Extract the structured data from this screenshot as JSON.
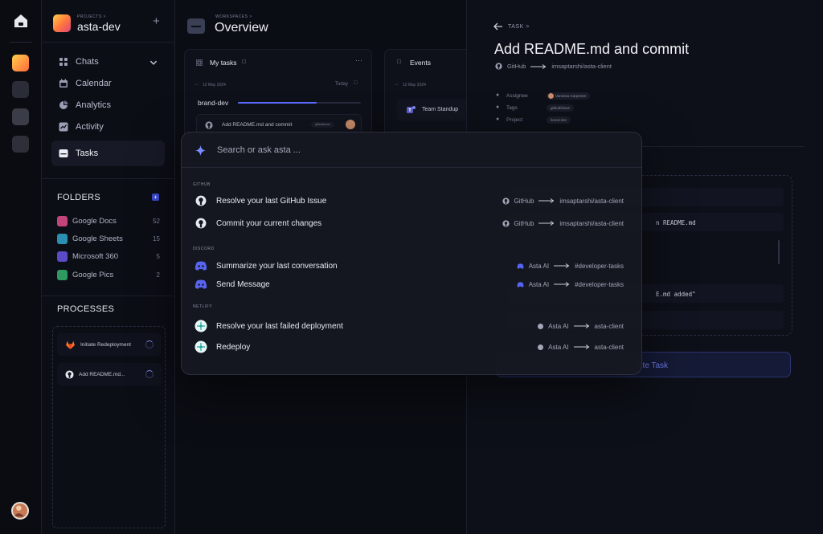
{
  "project": {
    "crumb": "PROJECTS >",
    "name": "asta-dev"
  },
  "nav": [
    {
      "label": "Chats",
      "icon": "chats-icon"
    },
    {
      "label": "Calendar",
      "icon": "calendar-icon"
    },
    {
      "label": "Analytics",
      "icon": "analytics-icon"
    },
    {
      "label": "Activity",
      "icon": "activity-icon"
    },
    {
      "label": "Tasks",
      "icon": "tasks-icon",
      "active": true
    }
  ],
  "folders": {
    "title": "FOLDERS",
    "items": [
      {
        "label": "Google Docs",
        "count": "52",
        "color": "#c2447a"
      },
      {
        "label": "Google Sheets",
        "count": "15",
        "color": "#2a8fb0"
      },
      {
        "label": "Microsoft 360",
        "count": "5",
        "color": "#5b4bc4"
      },
      {
        "label": "Google Pics",
        "count": "2",
        "color": "#2e9a62"
      }
    ]
  },
  "processes": {
    "title": "PROCESSES",
    "items": [
      {
        "label": "Initiate Redeployment"
      },
      {
        "label": "Add README.md..."
      }
    ]
  },
  "main": {
    "crumb": "WORKSPACES >",
    "title": "Overview",
    "my_tasks": {
      "title": "My tasks",
      "date": "12 May 2024",
      "today": "Today",
      "group": "brand-dev",
      "task": "Add README.md and commit",
      "tag": "github/issue"
    },
    "events": {
      "title": "Events",
      "date": "12 May 2024",
      "event": "Team Standup"
    }
  },
  "task": {
    "crumb": "TASK >",
    "title": "Add README.md and commit",
    "source": "GitHub",
    "target": "imsaptarshi/asta-client",
    "meta": [
      {
        "label": "Assignee",
        "value": "Vanessa Carpenter"
      },
      {
        "label": "Tags",
        "value": "github/issue"
      },
      {
        "label": "Project",
        "value": "brand-dev"
      }
    ],
    "code1": "n README.md",
    "code2": "E.md added\"",
    "button": "ete Task"
  },
  "palette": {
    "placeholder": "Search or ask asta ...",
    "groups": [
      {
        "title": "GITHUB",
        "items": [
          {
            "label": "Resolve your last GitHub Issue",
            "from": "GitHub",
            "to": "imsaptarshi/asta-client",
            "icon": "github-icon"
          },
          {
            "label": "Commit your current changes",
            "from": "GitHub",
            "to": "imsaptarshi/asta-client",
            "icon": "github-icon"
          }
        ]
      },
      {
        "title": "DISCORD",
        "items": [
          {
            "label": "Summarize your last conversation",
            "from": "Asta AI",
            "to": "#developer-tasks",
            "icon": "discord-icon"
          },
          {
            "label": "Send Message",
            "from": "Asta AI",
            "to": "#developer-tasks",
            "icon": "discord-icon"
          }
        ]
      },
      {
        "title": "NETLIFY",
        "items": [
          {
            "label": "Resolve your last failed deployment",
            "from": "Asta AI",
            "to": "asta-client",
            "icon": "netlify-icon"
          },
          {
            "label": "Redeploy",
            "from": "Asta AI",
            "to": "asta-client",
            "icon": "netlify-icon"
          }
        ]
      }
    ]
  },
  "colors": {
    "accent": "#5b6cff",
    "background": "#0b0d14"
  }
}
